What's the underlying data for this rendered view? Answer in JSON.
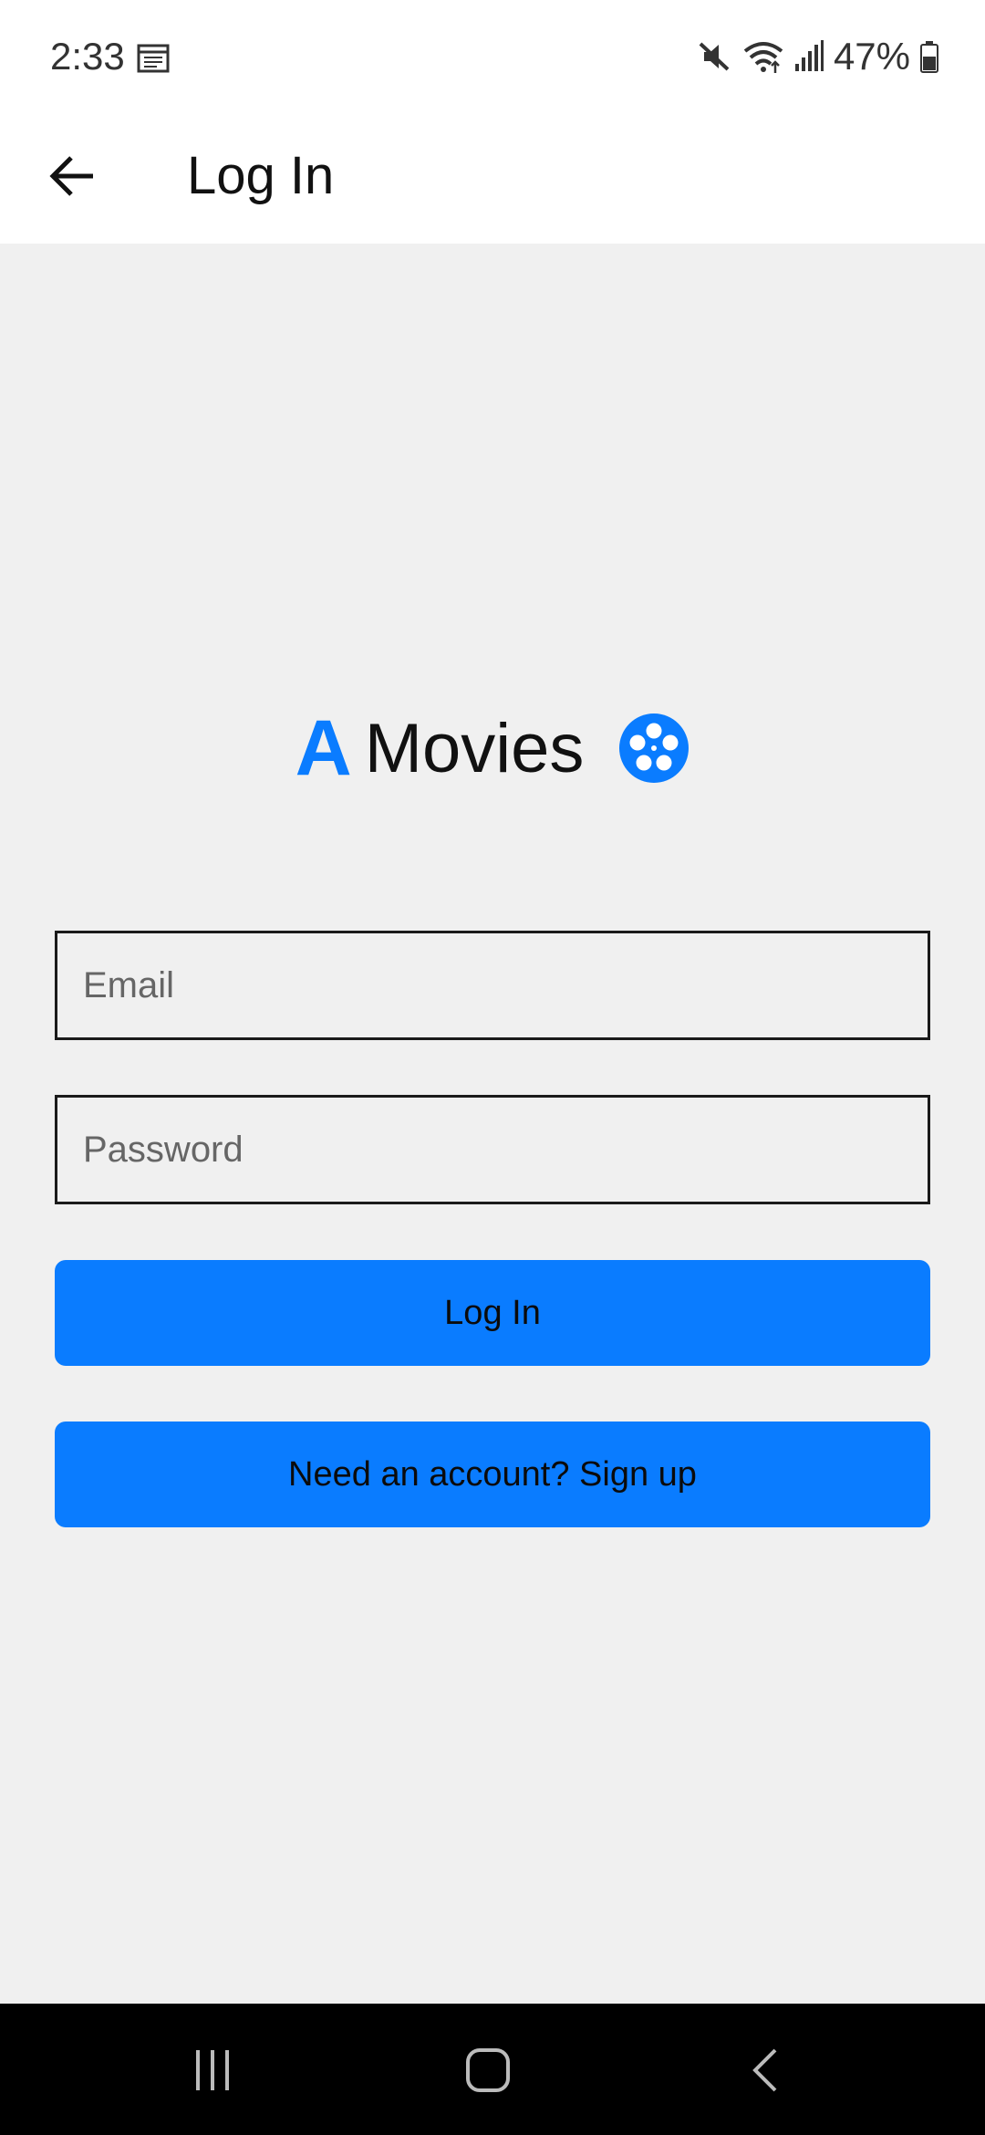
{
  "status_bar": {
    "time": "2:33",
    "battery": "47%",
    "icons": [
      "calendar-icon",
      "mute-icon",
      "wifi-icon",
      "signal-icon",
      "battery-icon"
    ]
  },
  "app_bar": {
    "title": "Log In",
    "back_icon": "back-arrow-icon"
  },
  "logo": {
    "letter": "A",
    "text": "Movies",
    "icon": "film-reel-icon"
  },
  "form": {
    "email_placeholder": "Email",
    "email_value": "",
    "password_placeholder": "Password",
    "password_value": "",
    "login_label": "Log In",
    "signup_label": "Need an account? Sign up"
  },
  "nav_bar": {
    "icons": [
      "recents-icon",
      "home-icon",
      "back-icon"
    ]
  },
  "colors": {
    "accent": "#0a7cff",
    "background": "#f0f0f0",
    "app_bar": "#ffffff",
    "nav_bar": "#000000"
  }
}
